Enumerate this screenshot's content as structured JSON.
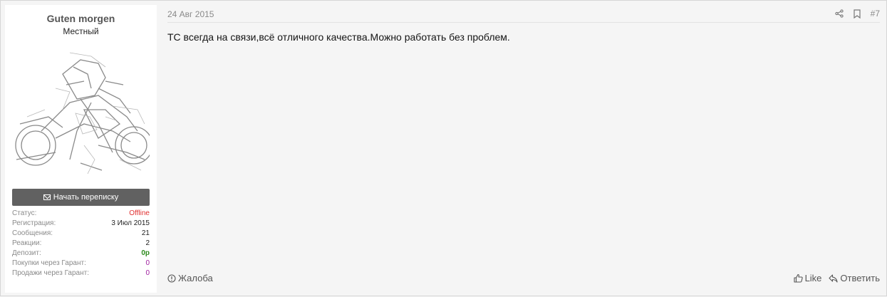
{
  "user": {
    "name": "Guten morgen",
    "title": "Местный",
    "pm_button": "Начать переписку",
    "stats": [
      {
        "label": "Статус:",
        "value": "Offline",
        "color": "#e03030"
      },
      {
        "label": "Регистрация:",
        "value": "3 Июл 2015",
        "color": "#222222"
      },
      {
        "label": "Сообщения:",
        "value": "21",
        "color": "#222222"
      },
      {
        "label": "Реакции:",
        "value": "2",
        "color": "#222222"
      },
      {
        "label": "Депозит:",
        "value": "0р",
        "color": "#2e8b1e"
      },
      {
        "label": "Покупки через Гарант:",
        "value": "0",
        "color": "#a020a0"
      },
      {
        "label": "Продажи через Гарант:",
        "value": "0",
        "color": "#a020a0"
      }
    ]
  },
  "post": {
    "date": "24 Авг 2015",
    "number": "#7",
    "body": "ТС всегда на связи,всё отличного качества.Можно работать без проблем.",
    "report": "Жалоба",
    "like": "Like",
    "reply": "Ответить"
  },
  "icons": {
    "share": "share-icon",
    "bookmark": "bookmark-icon",
    "report": "alert-circle-icon",
    "like": "thumbs-up-icon",
    "reply": "reply-icon",
    "pm": "envelope-icon"
  }
}
